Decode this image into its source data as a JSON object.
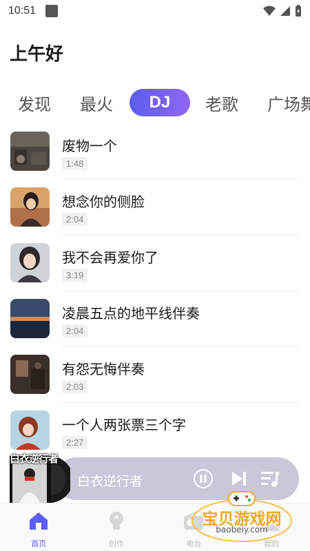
{
  "status_bar": {
    "time": "10:51"
  },
  "header": {
    "greeting": "上午好"
  },
  "tabs": [
    {
      "label": "发现"
    },
    {
      "label": "最火"
    },
    {
      "label": "DJ",
      "active": true
    },
    {
      "label": "老歌"
    },
    {
      "label": "广场舞"
    }
  ],
  "songs": [
    {
      "title": "废物一个",
      "duration": "1:48"
    },
    {
      "title": "想念你的侧脸",
      "duration": "2:04"
    },
    {
      "title": "我不会再爱你了",
      "duration": "3:19"
    },
    {
      "title": "凌晨五点的地平线伴奏",
      "duration": "2:04"
    },
    {
      "title": "有怨无悔伴奏",
      "duration": "2:03"
    },
    {
      "title": "一个人两张票三个字",
      "duration": "2:27"
    }
  ],
  "player": {
    "cover_text": "白衣逆行者",
    "song": "白衣逆行者"
  },
  "bottom_nav": [
    {
      "label": "首页",
      "icon": "home-icon"
    },
    {
      "label": "创作",
      "icon": "lightbulb-icon"
    },
    {
      "label": "电台",
      "icon": "radio-icon"
    },
    {
      "label": "我的",
      "icon": "profile-icon"
    }
  ],
  "watermark": {
    "text": "宝贝游戏网",
    "url": "baobeiy.com"
  },
  "colors": {
    "accent": "#5b5ef0",
    "accent_end": "#9266f2",
    "player_bg": "#c9c7da"
  }
}
